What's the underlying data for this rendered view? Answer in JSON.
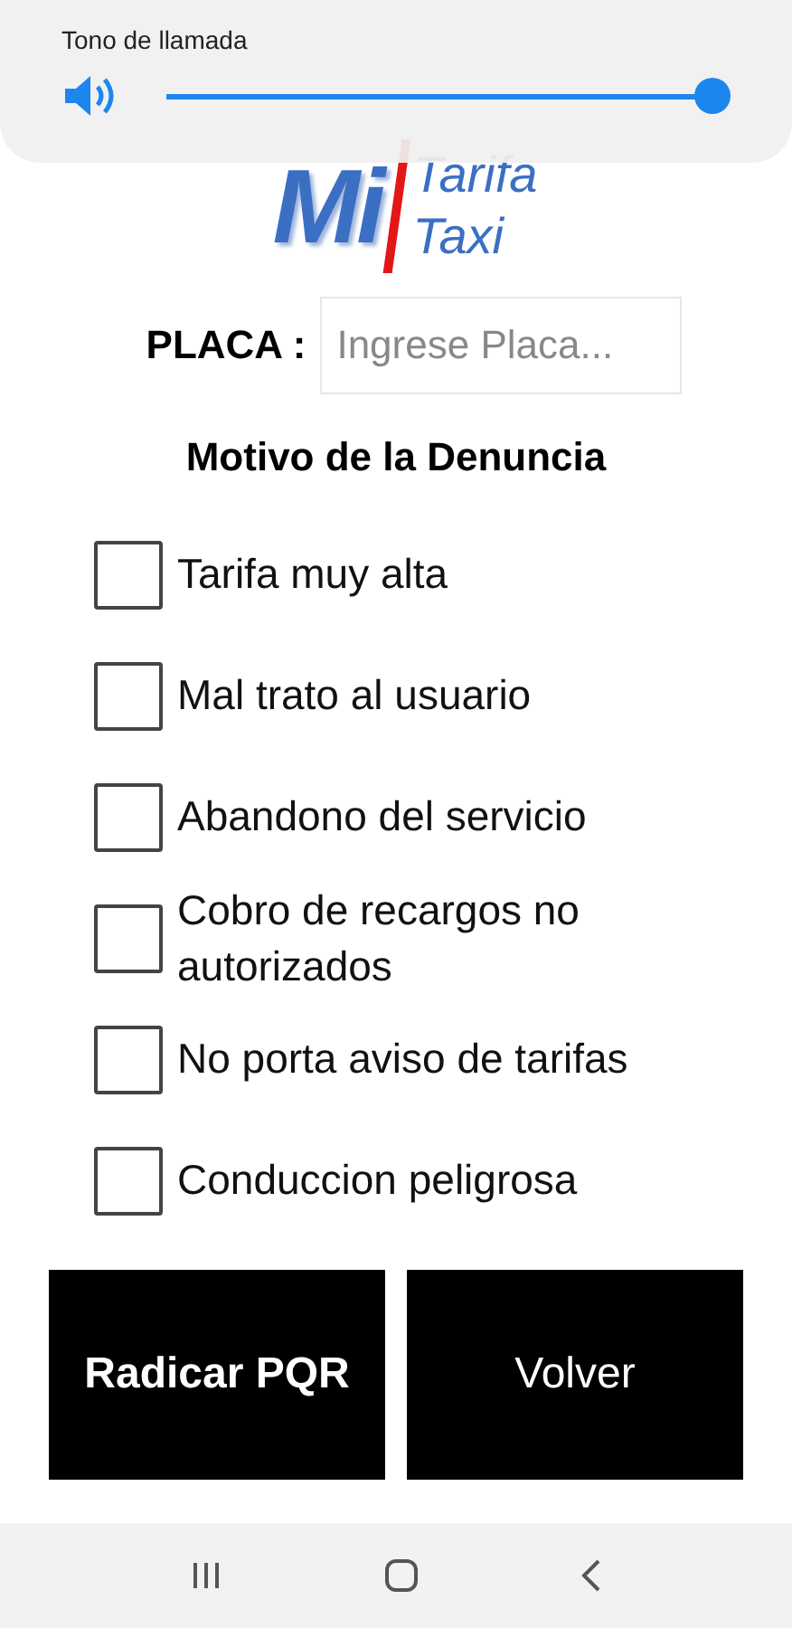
{
  "volume_panel": {
    "title": "Tono de llamada",
    "level": 1
  },
  "logo": {
    "word_1": "Mi",
    "word_2": "Tarifa",
    "word_3": "Taxi"
  },
  "plate": {
    "label": "PLACA :",
    "placeholder": "Ingrese Placa..."
  },
  "reasons_title": "Motivo de la Denuncia",
  "reasons": [
    {
      "label": "Tarifa muy alta",
      "checked": false
    },
    {
      "label": "Mal trato al usuario",
      "checked": false
    },
    {
      "label": "Abandono del servicio",
      "checked": false
    },
    {
      "label": "Cobro de recargos no autorizados",
      "checked": false
    },
    {
      "label": "No porta aviso de tarifas",
      "checked": false
    },
    {
      "label": "Conduccion peligrosa",
      "checked": false
    }
  ],
  "buttons": [
    {
      "label": "Radicar PQR",
      "bold": true
    },
    {
      "label": "Volver",
      "bold": false
    }
  ]
}
